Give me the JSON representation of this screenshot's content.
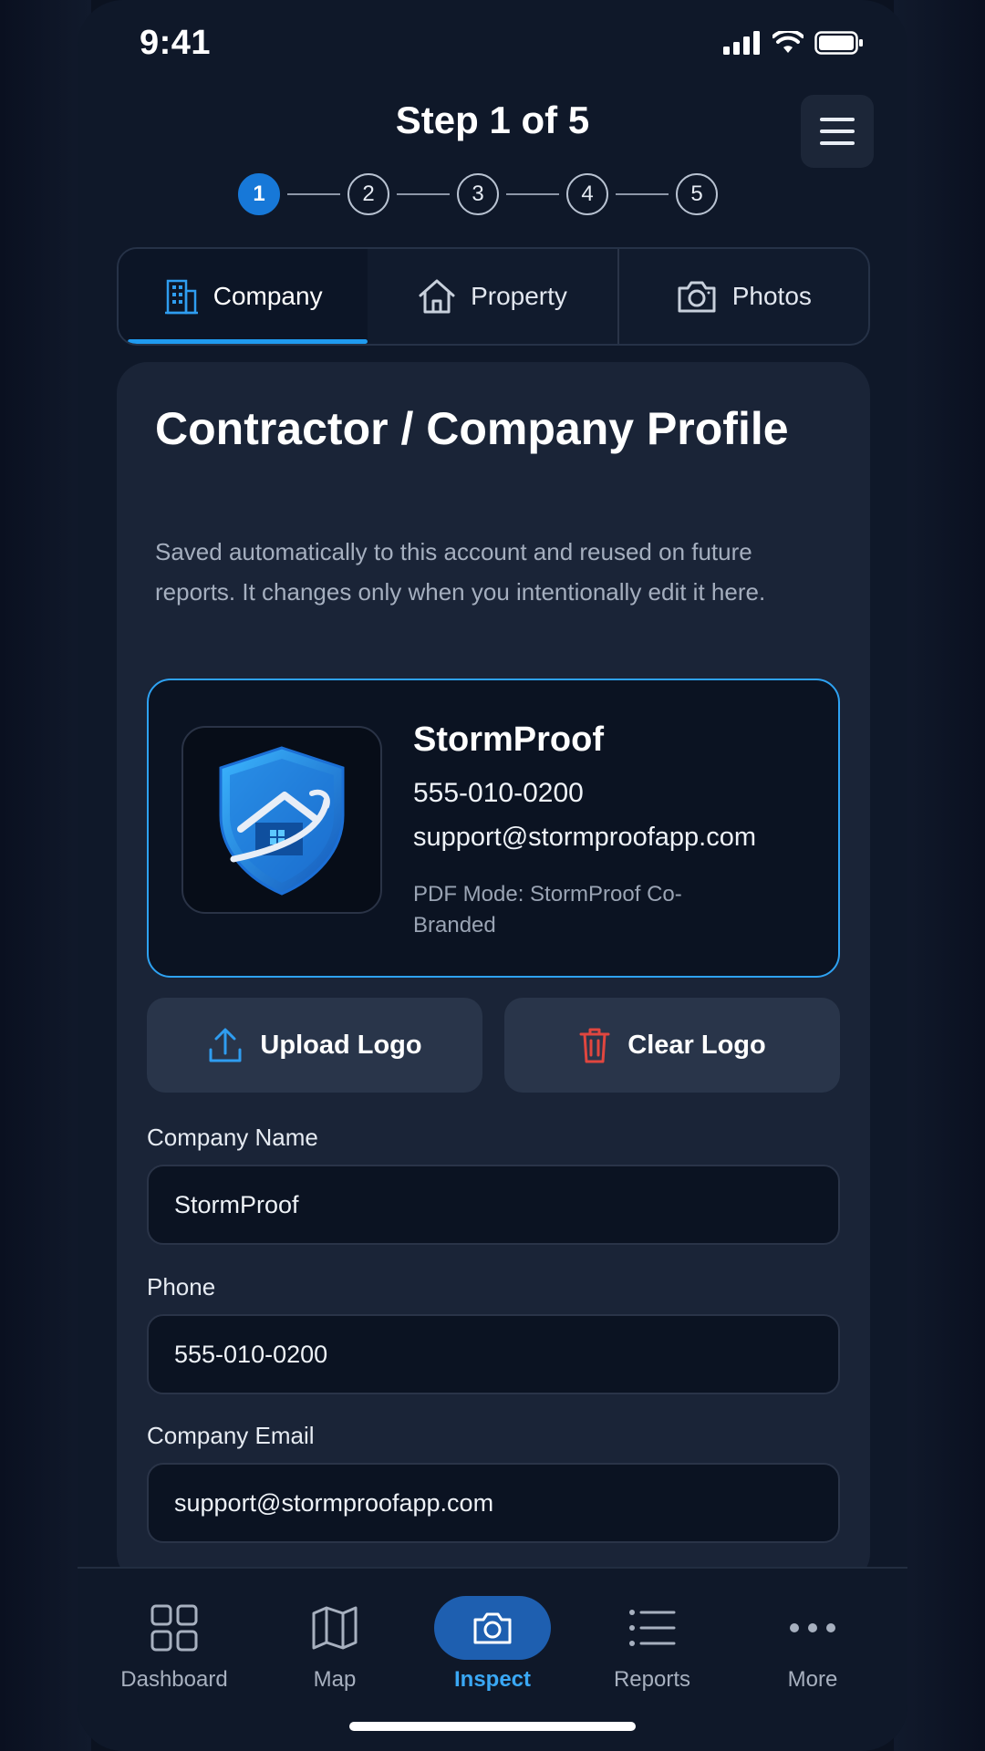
{
  "status_bar": {
    "time": "9:41"
  },
  "header": {
    "title": "Step 1 of 5",
    "steps": [
      "1",
      "2",
      "3",
      "4",
      "5"
    ],
    "active_step": 1
  },
  "tabs": [
    {
      "label": "Company",
      "icon": "building-icon",
      "active": true
    },
    {
      "label": "Property",
      "icon": "house-icon",
      "active": false
    },
    {
      "label": "Photos",
      "icon": "camera-icon",
      "active": false
    }
  ],
  "card": {
    "title": "Contractor / Company Profile",
    "description": "Saved automatically to this account and reused on future reports. It changes only when you intentionally edit it here.",
    "profile": {
      "name": "StormProof",
      "phone": "555-010-0200",
      "email": "support@stormproofapp.com",
      "pdf_mode": "PDF Mode: StormProof Co-Branded",
      "logo_icon": "shield-house-logo"
    },
    "buttons": {
      "upload_label": "Upload Logo",
      "clear_label": "Clear Logo"
    },
    "fields": {
      "company_name_label": "Company Name",
      "company_name_value": "StormProof",
      "phone_label": "Phone",
      "phone_value": "555-010-0200",
      "email_label": "Company Email",
      "email_value": "support@stormproofapp.com"
    }
  },
  "bottom_nav": [
    {
      "label": "Dashboard",
      "icon": "grid-icon",
      "active": false
    },
    {
      "label": "Map",
      "icon": "map-icon",
      "active": false
    },
    {
      "label": "Inspect",
      "icon": "camera-icon",
      "active": true
    },
    {
      "label": "Reports",
      "icon": "list-icon",
      "active": false
    },
    {
      "label": "More",
      "icon": "more-icon",
      "active": false
    }
  ],
  "colors": {
    "accent": "#1f9bf0",
    "active_nav": "#3aa8f5",
    "danger": "#e0463f",
    "background": "#0f1829"
  }
}
